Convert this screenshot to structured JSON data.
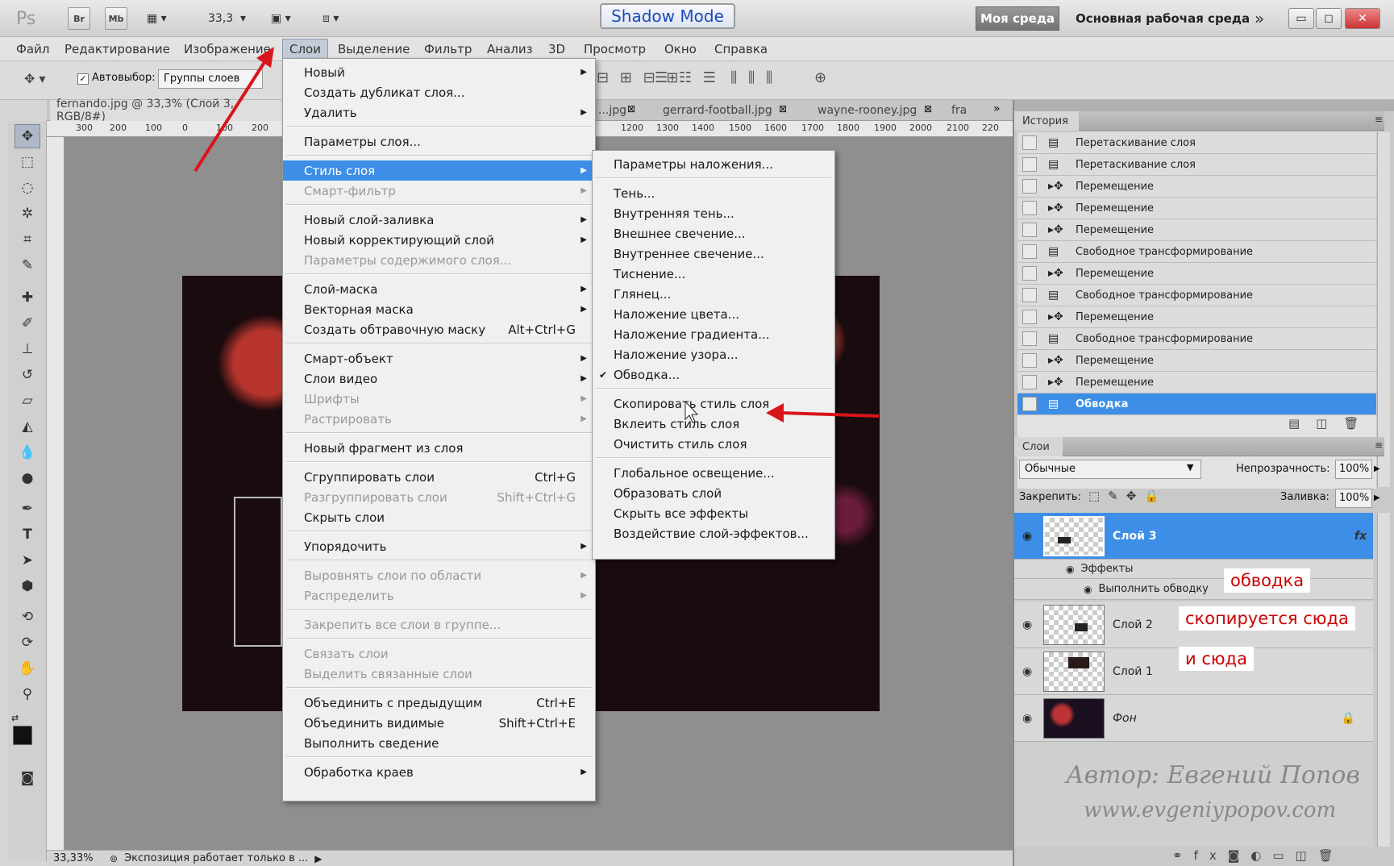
{
  "titlebar": {
    "ps_logo": "Ps",
    "br": "Br",
    "mb": "Mb",
    "zoom": "33,3",
    "shadow_mode": "Shadow Mode",
    "workspace_active": "Моя среда",
    "workspace_label": "Основная рабочая среда"
  },
  "menubar": [
    "Файл",
    "Редактирование",
    "Изображение",
    "Слои",
    "Выделение",
    "Фильтр",
    "Анализ",
    "3D",
    "Просмотр",
    "Окно",
    "Справка"
  ],
  "options": {
    "autoselect_label": "Автовыбор:",
    "autoselect_value": "Группы слоев"
  },
  "tabs": [
    "fernando.jpg @ 33,3% (Слой 3, RGB/8#)",
    "...jpg",
    "gerrard-football.jpg",
    "wayne-rooney.jpg",
    "fra"
  ],
  "ruler_h": [
    "300",
    "200",
    "100",
    "0",
    "100",
    "200",
    "1200",
    "1300",
    "1400",
    "1500",
    "1600",
    "1700",
    "1800",
    "1900",
    "2000",
    "2100",
    "220"
  ],
  "status": {
    "zoom": "33,33%",
    "text": "Экспозиция работает только в ..."
  },
  "layer_menu": {
    "items": [
      {
        "label": "Новый",
        "arrow": true
      },
      {
        "label": "Создать дубликат слоя..."
      },
      {
        "label": "Удалить",
        "arrow": true
      },
      {
        "label": "Параметры слоя..."
      },
      {
        "label": "Стиль слоя",
        "arrow": true,
        "selected": true
      },
      {
        "label": "Смарт-фильтр",
        "arrow": true,
        "disabled": true
      },
      {
        "label": "Новый слой-заливка",
        "arrow": true
      },
      {
        "label": "Новый корректирующий слой",
        "arrow": true
      },
      {
        "label": "Параметры содержимого слоя...",
        "disabled": true
      },
      {
        "label": "Слой-маска",
        "arrow": true
      },
      {
        "label": "Векторная маска",
        "arrow": true
      },
      {
        "label": "Создать обтравочную маску",
        "shortcut": "Alt+Ctrl+G"
      },
      {
        "label": "Смарт-объект",
        "arrow": true
      },
      {
        "label": "Слои видео",
        "arrow": true
      },
      {
        "label": "Шрифты",
        "arrow": true,
        "disabled": true
      },
      {
        "label": "Растрировать",
        "arrow": true,
        "disabled": true
      },
      {
        "label": "Новый фрагмент из слоя"
      },
      {
        "label": "Сгруппировать слои",
        "shortcut": "Ctrl+G"
      },
      {
        "label": "Разгруппировать слои",
        "shortcut": "Shift+Ctrl+G",
        "disabled": true
      },
      {
        "label": "Скрыть слои"
      },
      {
        "label": "Упорядочить",
        "arrow": true
      },
      {
        "label": "Выровнять слои по области",
        "arrow": true,
        "disabled": true
      },
      {
        "label": "Распределить",
        "arrow": true,
        "disabled": true
      },
      {
        "label": "Закрепить все слои в группе...",
        "disabled": true
      },
      {
        "label": "Связать слои",
        "disabled": true
      },
      {
        "label": "Выделить связанные слои",
        "disabled": true
      },
      {
        "label": "Объединить с предыдущим",
        "shortcut": "Ctrl+E"
      },
      {
        "label": "Объединить видимые",
        "shortcut": "Shift+Ctrl+E"
      },
      {
        "label": "Выполнить сведение"
      },
      {
        "label": "Обработка краев",
        "arrow": true
      }
    ]
  },
  "style_menu": {
    "items": [
      {
        "label": "Параметры наложения..."
      },
      {
        "label": "Тень..."
      },
      {
        "label": "Внутренняя тень..."
      },
      {
        "label": "Внешнее свечение..."
      },
      {
        "label": "Внутреннее свечение..."
      },
      {
        "label": "Тиснение..."
      },
      {
        "label": "Глянец..."
      },
      {
        "label": "Наложение цвета..."
      },
      {
        "label": "Наложение градиента..."
      },
      {
        "label": "Наложение узора..."
      },
      {
        "label": "Обводка...",
        "checked": true
      },
      {
        "label": "Скопировать стиль слоя"
      },
      {
        "label": "Вклеить стиль слоя"
      },
      {
        "label": "Очистить стиль слоя"
      },
      {
        "label": "Глобальное освещение..."
      },
      {
        "label": "Образовать слой"
      },
      {
        "label": "Скрыть все эффекты"
      },
      {
        "label": "Воздействие слой-эффектов..."
      }
    ]
  },
  "history": {
    "title": "История",
    "items": [
      "Перетаскивание слоя",
      "Перетаскивание слоя",
      "Перемещение",
      "Перемещение",
      "Перемещение",
      "Свободное трансформирование",
      "Перемещение",
      "Свободное трансформирование",
      "Перемещение",
      "Свободное трансформирование",
      "Перемещение",
      "Перемещение",
      "Обводка"
    ]
  },
  "layers": {
    "title": "Слои",
    "blend": "Обычные",
    "opacity_label": "Непрозрачность:",
    "opacity": "100%",
    "lock_label": "Закрепить:",
    "fill_label": "Заливка:",
    "fill": "100%",
    "layer3": "Слой 3",
    "fx": "fx",
    "effects": "Эффекты",
    "stroke": "Выполнить обводку",
    "layer2": "Слой 2",
    "layer1": "Слой 1",
    "bg": "Фон"
  },
  "annotations": {
    "a1": "обводка",
    "a2": "скопируется сюда",
    "a3": "и сюда"
  },
  "watermark": {
    "line1": "Автор: Евгений Попов",
    "line2": "www.evgeniypopov.com"
  },
  "colors": {
    "accent": "#3d8ee6",
    "arrow": "#d8151b"
  }
}
